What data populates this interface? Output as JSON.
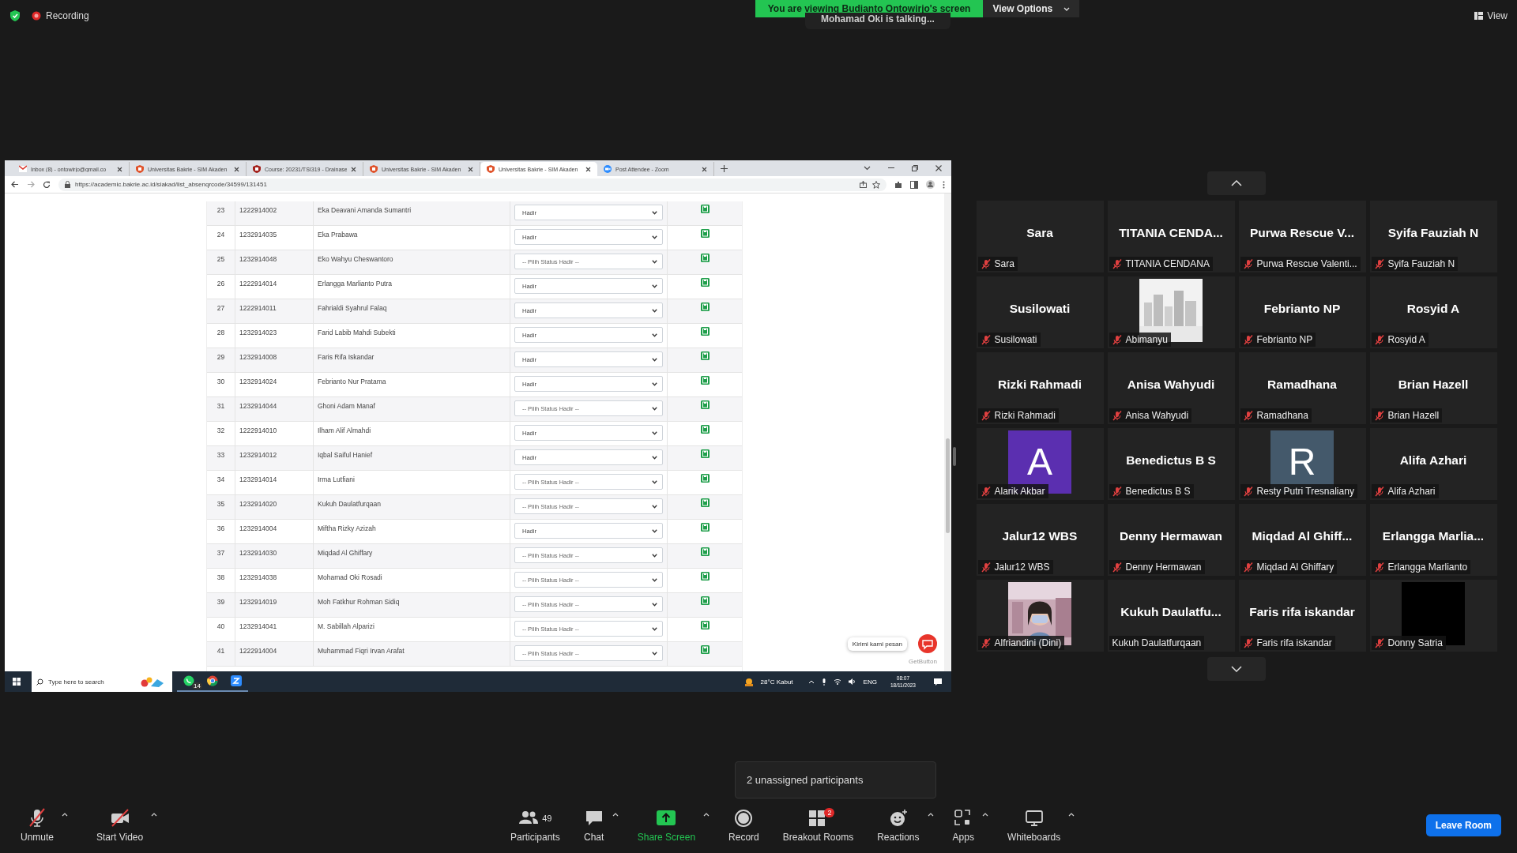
{
  "top_bar": {
    "recording": "Recording",
    "banner": "You are viewing Budianto Ontowirjo's screen",
    "view_options": "View Options",
    "talking": "Mohamad Oki is talking...",
    "view": "View"
  },
  "shared_screen": {
    "browser": {
      "tabs": [
        {
          "title": "Inbox (8) - ontowirjo@gmail.co",
          "kind": "mail",
          "selected": false
        },
        {
          "title": "Universitas Bakrie - SIM Akaden",
          "kind": "shield",
          "selected": false
        },
        {
          "title": "Course: 20231/TSI319 - Drainase",
          "kind": "shield-dark",
          "selected": false
        },
        {
          "title": "Universitas Bakrie - SIM Akaden",
          "kind": "shield",
          "selected": false
        },
        {
          "title": "Universitas Bakrie - SIM Akaden",
          "kind": "shield",
          "selected": true
        },
        {
          "title": "Post Attendee - Zoom",
          "kind": "zoom",
          "selected": false
        }
      ],
      "url": "https://academic.bakrie.ac.id/siakad/list_absenqrcode/34599/131451"
    },
    "table": {
      "rows": [
        {
          "no": "23",
          "nim": "1222914002",
          "name": "Eka Deavani Amanda Sumantri",
          "status": "Hadir",
          "chosen": true
        },
        {
          "no": "24",
          "nim": "1232914035",
          "name": "Eka Prabawa",
          "status": "Hadir",
          "chosen": true
        },
        {
          "no": "25",
          "nim": "1232914048",
          "name": "Eko Wahyu Cheswantoro",
          "status": "-- Pilih Status Hadir --",
          "chosen": false
        },
        {
          "no": "26",
          "nim": "1222914014",
          "name": "Erlangga Marlianto Putra",
          "status": "Hadir",
          "chosen": true
        },
        {
          "no": "27",
          "nim": "1222914011",
          "name": "Fahrialdi Syahrul Falaq",
          "status": "Hadir",
          "chosen": true
        },
        {
          "no": "28",
          "nim": "1232914023",
          "name": "Farid Labib Mahdi Subekti",
          "status": "Hadir",
          "chosen": true
        },
        {
          "no": "29",
          "nim": "1232914008",
          "name": "Faris Rifa Iskandar",
          "status": "Hadir",
          "chosen": true
        },
        {
          "no": "30",
          "nim": "1232914024",
          "name": "Febrianto Nur Pratama",
          "status": "Hadir",
          "chosen": true
        },
        {
          "no": "31",
          "nim": "1232914044",
          "name": "Ghoni Adam Manaf",
          "status": "-- Pilih Status Hadir --",
          "chosen": false
        },
        {
          "no": "32",
          "nim": "1222914010",
          "name": "Ilham Alif Almahdi",
          "status": "Hadir",
          "chosen": true
        },
        {
          "no": "33",
          "nim": "1232914012",
          "name": "Iqbal Saiful Hanief",
          "status": "Hadir",
          "chosen": true
        },
        {
          "no": "34",
          "nim": "1232914014",
          "name": "Irma Lutfiani",
          "status": "-- Pilih Status Hadir --",
          "chosen": false
        },
        {
          "no": "35",
          "nim": "1232914020",
          "name": "Kukuh Daulatfurqaan",
          "status": "-- Pilih Status Hadir --",
          "chosen": false
        },
        {
          "no": "36",
          "nim": "1232914004",
          "name": "Miftha Rizky Azizah",
          "status": "Hadir",
          "chosen": true
        },
        {
          "no": "37",
          "nim": "1232914030",
          "name": "Miqdad Al Ghiffary",
          "status": "-- Pilih Status Hadir --",
          "chosen": false
        },
        {
          "no": "38",
          "nim": "1232914038",
          "name": "Mohamad Oki Rosadi",
          "status": "-- Pilih Status Hadir --",
          "chosen": false
        },
        {
          "no": "39",
          "nim": "1232914019",
          "name": "Moh Fatkhur Rohman Sidiq",
          "status": "-- Pilih Status Hadir --",
          "chosen": false
        },
        {
          "no": "40",
          "nim": "1232914041",
          "name": "M. Sabillah Alparizi",
          "status": "-- Pilih Status Hadir --",
          "chosen": false
        },
        {
          "no": "41",
          "nim": "1222914004",
          "name": "Muhammad Fiqri Irvan Arafat",
          "status": "-- Pilih Status Hadir --",
          "chosen": false
        }
      ]
    },
    "chat_widget": {
      "button": "Kirimi kami pesan",
      "credit": "GetButton"
    },
    "taskbar": {
      "search_placeholder": "Type here to search",
      "whatsapp_badge": "14",
      "weather": "28°C  Kabut",
      "language": "ENG",
      "time": "08:07",
      "date": "18/11/2023"
    }
  },
  "gallery": {
    "tiles": [
      {
        "kind": "name",
        "title": "Sara",
        "label": "Sara",
        "muted": true
      },
      {
        "kind": "name",
        "title": "TITANIA CENDA...",
        "label": "TITANIA CENDANA",
        "muted": true
      },
      {
        "kind": "name",
        "title": "Purwa Rescue V...",
        "label": "Purwa Rescue Valenti...",
        "muted": true
      },
      {
        "kind": "name",
        "title": "Syifa Fauziah N",
        "label": "Syifa Fauziah N",
        "muted": true
      },
      {
        "kind": "name",
        "title": "Susilowati",
        "label": "Susilowati",
        "muted": true
      },
      {
        "kind": "picture",
        "label": "Abimanyu",
        "muted": true
      },
      {
        "kind": "name",
        "title": "Febrianto NP",
        "label": "Febrianto NP",
        "muted": true
      },
      {
        "kind": "name",
        "title": "Rosyid A",
        "label": "Rosyid A",
        "muted": true
      },
      {
        "kind": "name",
        "title": "Rizki Rahmadi",
        "label": "Rizki Rahmadi",
        "muted": true
      },
      {
        "kind": "name",
        "title": "Anisa Wahyudi",
        "label": "Anisa Wahyudi",
        "muted": true
      },
      {
        "kind": "name",
        "title": "Ramadhana",
        "label": "Ramadhana",
        "muted": true
      },
      {
        "kind": "name",
        "title": "Brian Hazell",
        "label": "Brian Hazell",
        "muted": true
      },
      {
        "kind": "letter",
        "letter": "A",
        "color": "#5b2fb0",
        "label": "Alarik Akbar",
        "muted": true
      },
      {
        "kind": "name",
        "title": "Benedictus B S",
        "label": "Benedictus B S",
        "muted": true
      },
      {
        "kind": "letter",
        "letter": "R",
        "color": "#44596b",
        "label": "Resty Putri Tresnaliany",
        "muted": true
      },
      {
        "kind": "name",
        "title": "Alifa Azhari",
        "label": "Alifa Azhari",
        "muted": true
      },
      {
        "kind": "name",
        "title": "Jalur12 WBS",
        "label": "Jalur12 WBS",
        "muted": true
      },
      {
        "kind": "name",
        "title": "Denny Hermawan",
        "label": "Denny Hermawan",
        "muted": true
      },
      {
        "kind": "name",
        "title": "Miqdad Al Ghiff...",
        "label": "Miqdad Al Ghiffary",
        "muted": true
      },
      {
        "kind": "name",
        "title": "Erlangga Marlia...",
        "label": "Erlangga Marlianto",
        "muted": true
      },
      {
        "kind": "picture",
        "label": "Alfriandini (Dini)",
        "muted": true
      },
      {
        "kind": "name",
        "title": "Kukuh Daulatfu...",
        "label": "Kukuh Daulatfurqaan",
        "muted": false
      },
      {
        "kind": "name",
        "title": "Faris rifa iskandar",
        "label": "Faris rifa iskandar",
        "muted": true
      },
      {
        "kind": "blank",
        "label": "Donny Satria",
        "muted": true
      }
    ]
  },
  "tooltip": "2 unassigned participants",
  "toolbar": {
    "left": [
      {
        "kind": "mic_muted",
        "label": "Unmute",
        "caret": true
      },
      {
        "kind": "video_off",
        "label": "Start Video",
        "caret": true
      }
    ],
    "center": [
      {
        "kind": "participants",
        "label": "Participants",
        "count": "49"
      },
      {
        "kind": "chat",
        "label": "Chat",
        "caret": true
      },
      {
        "kind": "share",
        "label": "Share Screen",
        "caret": true,
        "highlight": true
      },
      {
        "kind": "record",
        "label": "Record"
      },
      {
        "kind": "breakout",
        "label": "Breakout Rooms",
        "badge": "2"
      },
      {
        "kind": "reactions",
        "label": "Reactions",
        "caret": true
      },
      {
        "kind": "apps",
        "label": "Apps",
        "caret": true
      },
      {
        "kind": "whiteboards",
        "label": "Whiteboards",
        "caret": true
      }
    ],
    "leave": "Leave Room"
  }
}
